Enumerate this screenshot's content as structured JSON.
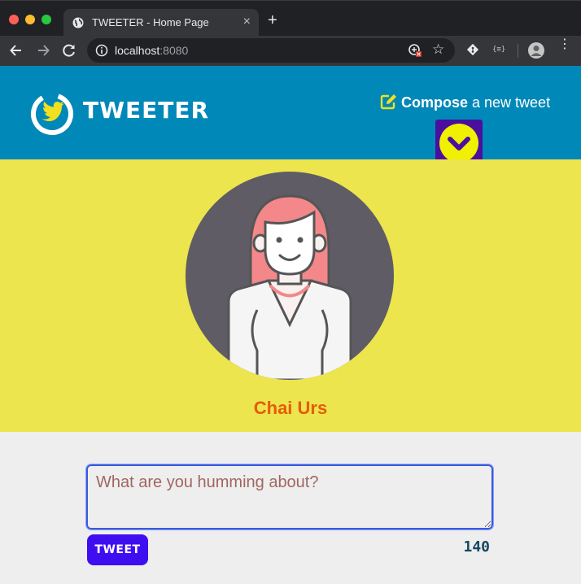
{
  "browser": {
    "tab_title": "TWEETER - Home Page",
    "tab_close": "×",
    "new_tab": "+",
    "url_host": "localhost",
    "url_port": ":8080",
    "star": "☆",
    "json_ext": "{≡}",
    "menu": "⋮"
  },
  "nav": {
    "brand": "TWEETER",
    "compose_bold": "Compose",
    "compose_rest": " a new tweet",
    "accent": "#0088b8",
    "toggle_color": "#4b0fa0",
    "toggle_icon": "chevron-down-icon"
  },
  "profile": {
    "name": "Chai Urs",
    "bg": "#ece54d",
    "name_color": "#e45c09"
  },
  "composer": {
    "placeholder": "What are you humming about?",
    "tweet_label": "TWEET",
    "counter": "140"
  }
}
